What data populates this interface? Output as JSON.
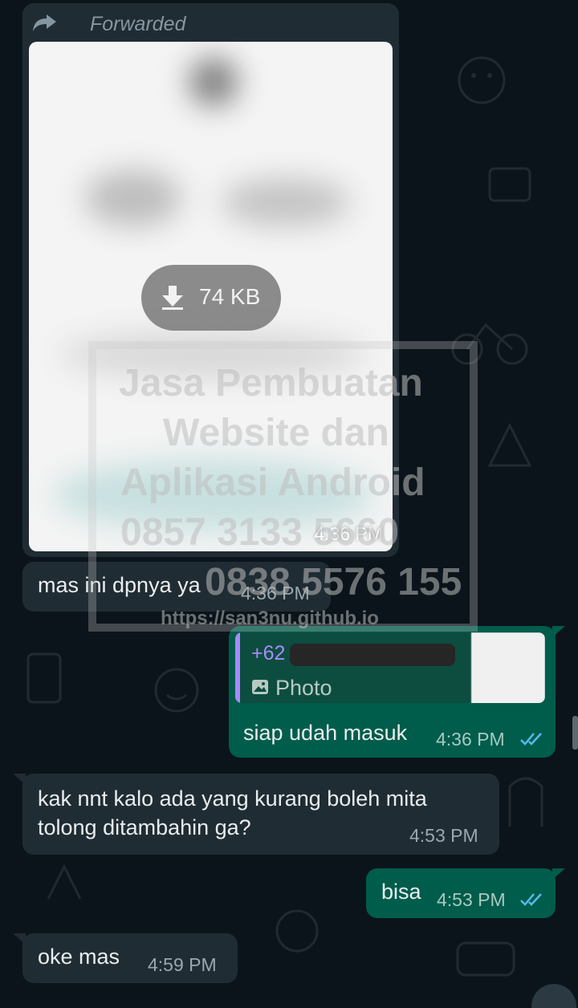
{
  "forwarded_message": {
    "label": "Forwarded",
    "download_size": "74 KB",
    "time": "4:36 PM"
  },
  "watermark": {
    "line1": "Jasa Pembuatan",
    "line2": "Website dan",
    "line3": "Aplikasi Android",
    "line4": "0857 3133 5660",
    "line5": "0838 5576 155",
    "line6": "https://san3nu.github.io"
  },
  "messages": [
    {
      "text": "mas ini dpnya ya",
      "time": "4:36 PM"
    },
    {
      "quote_sender": "+62",
      "quote_type": "Photo",
      "text": "siap udah masuk",
      "time": "4:36 PM"
    },
    {
      "line1": "kak nnt kalo ada yang kurang boleh mita",
      "line2": "tolong ditambahin ga?",
      "time": "4:53 PM"
    },
    {
      "text": "bisa",
      "time": "4:53 PM"
    },
    {
      "text": "oke mas",
      "time": "4:59 PM"
    }
  ],
  "colors": {
    "background": "#0b141a",
    "incoming_bubble": "#202c33",
    "outgoing_bubble": "#005c4b",
    "read_ticks": "#53bdeb"
  }
}
